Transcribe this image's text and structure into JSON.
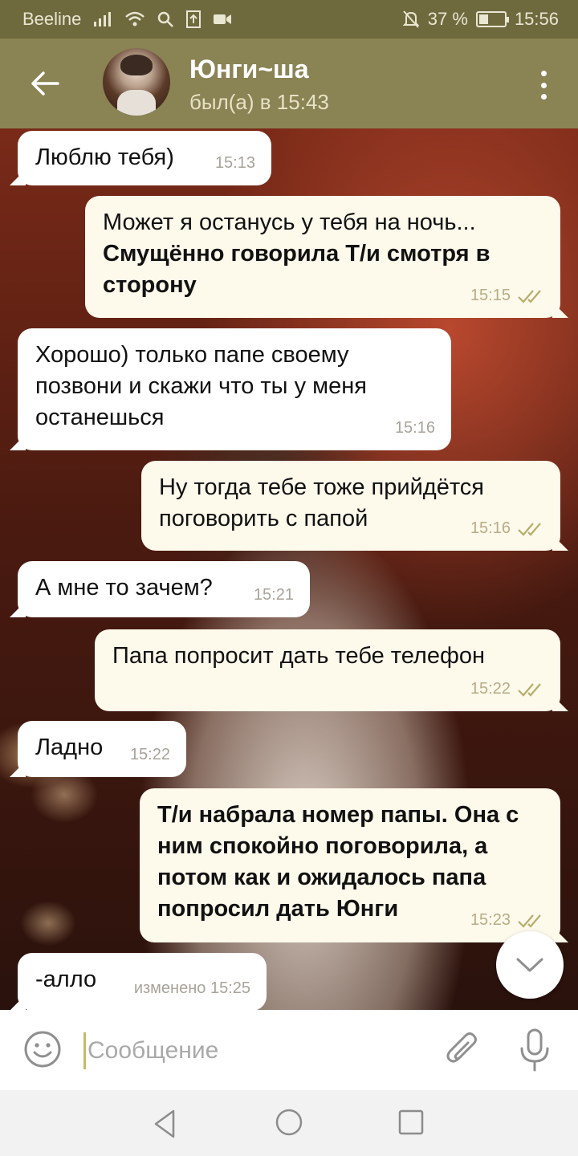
{
  "status_bar": {
    "carrier": "Beeline",
    "battery": "37 %",
    "battery_level": 0.37,
    "time": "15:56"
  },
  "header": {
    "contact_name": "Юнги~ша",
    "last_seen": "был(а) в 15:43"
  },
  "messages": [
    {
      "dir": "in",
      "text": "Люблю тебя)",
      "time": "15:13"
    },
    {
      "dir": "out",
      "text": "Может я останусь у тебя на ночь...",
      "bold": "Смущённо говорила Т/и смотря в сторону",
      "time": "15:15"
    },
    {
      "dir": "in",
      "text": "Хорошо) только папе своему позвони и скажи что ты у меня останешься",
      "time": "15:16"
    },
    {
      "dir": "out",
      "text": "Ну тогда тебе тоже прийдётся поговорить с папой",
      "time": "15:16"
    },
    {
      "dir": "in",
      "text": "А мне то зачем?",
      "time": "15:21"
    },
    {
      "dir": "out",
      "text": "Папа попросит дать тебе телефон",
      "time": "15:22"
    },
    {
      "dir": "in",
      "text": "Ладно",
      "time": "15:22"
    },
    {
      "dir": "out",
      "bold": "Т/и набрала номер папы. Она с ним спокойно поговорила, а потом как и ожидалось папа попросил дать Юнги",
      "time": "15:23"
    },
    {
      "dir": "in",
      "text": "-алло",
      "time": "изменено 15:25"
    }
  ],
  "input": {
    "placeholder": "Сообщение"
  },
  "colors": {
    "header": "#8a8354",
    "status_bar": "#6f6a3e",
    "outgoing_bubble": "#fdf9eb",
    "incoming_bubble": "#ffffff",
    "check_marks": "#b7ac6b"
  },
  "icons": [
    "back-arrow-icon",
    "more-vert-icon",
    "double-check-icon",
    "chevron-down-icon",
    "emoji-icon",
    "paperclip-icon",
    "microphone-icon",
    "nav-back-icon",
    "nav-home-icon",
    "nav-recent-icon"
  ]
}
